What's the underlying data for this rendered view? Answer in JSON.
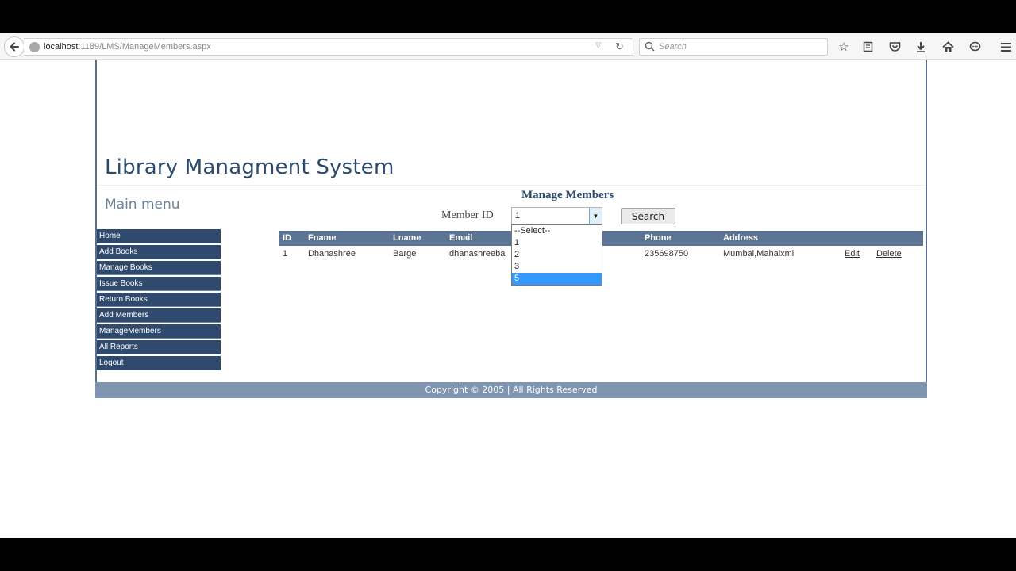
{
  "browser": {
    "url_host": "localhost",
    "url_path": ":1189/LMS/ManageMembers.aspx",
    "search_placeholder": "Search"
  },
  "site": {
    "title": "Library Managment System",
    "menu_heading": "Main menu",
    "menu": [
      "Home",
      "Add Books",
      "Manage Books",
      "Issue Books",
      "Return Books",
      "Add Members",
      "ManageMembers",
      "All Reports",
      "Logout"
    ]
  },
  "manage": {
    "heading": "Manage Members",
    "member_label": "Member ID",
    "selected_value": "1",
    "search_label": "Search",
    "dropdown_options": [
      "--Select--",
      "1",
      "2",
      "3",
      "5"
    ],
    "highlighted_option": "5"
  },
  "table": {
    "headers": [
      "ID",
      "Fname",
      "Lname",
      "Email",
      "Phone",
      "Address"
    ],
    "rows": [
      {
        "id": "1",
        "fname": "Dhanashree",
        "lname": "Barge",
        "email": "dhanashreeba",
        "phone": "235698750",
        "address": "Mumbai,Mahalxmi",
        "edit": "Edit",
        "delete": "Delete"
      }
    ]
  },
  "footer": {
    "text": "Copyright © 2005 | All Rights Reserved"
  }
}
